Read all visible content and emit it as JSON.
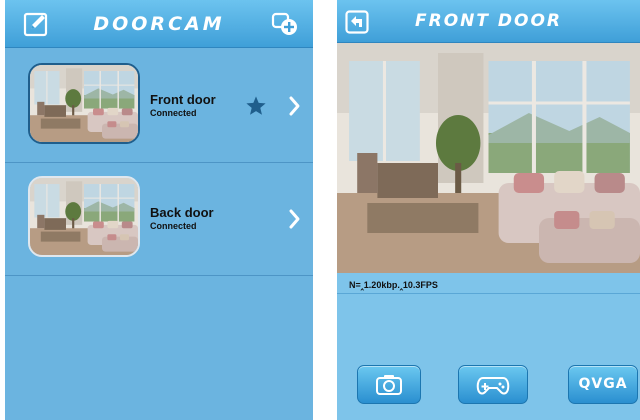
{
  "list_screen": {
    "title": "DOORCAM",
    "header_icons": {
      "left": "edit-icon",
      "right": "add-camera-icon"
    },
    "cameras": [
      {
        "name": "Front door",
        "status": "Connected",
        "favorite": true
      },
      {
        "name": "Back door",
        "status": "Connected",
        "favorite": false
      }
    ]
  },
  "view_screen": {
    "title": "FRONT DOOR",
    "back_icon": "back-arrow-icon",
    "stats": "N=‸1.20kbp.‸10.3FPS",
    "controls": {
      "snapshot_icon": "camera-icon",
      "ptz_icon": "gamepad-icon",
      "resolution_label": "QVGA"
    }
  },
  "colors": {
    "header_top": "#6cc3ef",
    "header_bottom": "#3f9fd8",
    "list_background": "#6bb4e0",
    "view_background": "#7ec4ea",
    "favorite_star": "#1f5e8c"
  }
}
